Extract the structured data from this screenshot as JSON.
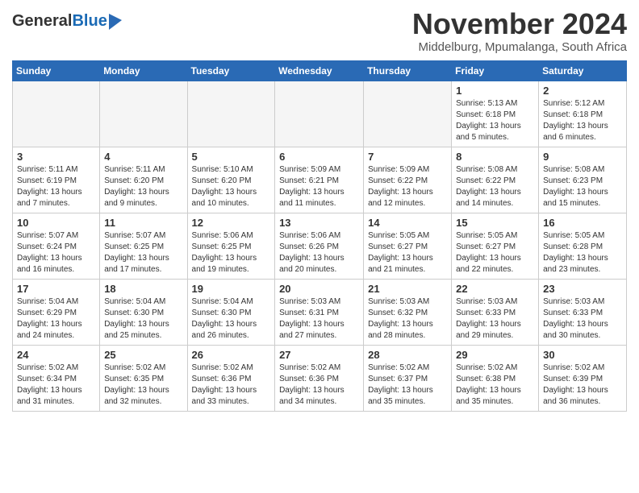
{
  "logo": {
    "general": "General",
    "blue": "Blue"
  },
  "title": "November 2024",
  "subtitle": "Middelburg, Mpumalanga, South Africa",
  "days_header": [
    "Sunday",
    "Monday",
    "Tuesday",
    "Wednesday",
    "Thursday",
    "Friday",
    "Saturday"
  ],
  "weeks": [
    [
      {
        "day": "",
        "info": ""
      },
      {
        "day": "",
        "info": ""
      },
      {
        "day": "",
        "info": ""
      },
      {
        "day": "",
        "info": ""
      },
      {
        "day": "",
        "info": ""
      },
      {
        "day": "1",
        "info": "Sunrise: 5:13 AM\nSunset: 6:18 PM\nDaylight: 13 hours and 5 minutes."
      },
      {
        "day": "2",
        "info": "Sunrise: 5:12 AM\nSunset: 6:18 PM\nDaylight: 13 hours and 6 minutes."
      }
    ],
    [
      {
        "day": "3",
        "info": "Sunrise: 5:11 AM\nSunset: 6:19 PM\nDaylight: 13 hours and 7 minutes."
      },
      {
        "day": "4",
        "info": "Sunrise: 5:11 AM\nSunset: 6:20 PM\nDaylight: 13 hours and 9 minutes."
      },
      {
        "day": "5",
        "info": "Sunrise: 5:10 AM\nSunset: 6:20 PM\nDaylight: 13 hours and 10 minutes."
      },
      {
        "day": "6",
        "info": "Sunrise: 5:09 AM\nSunset: 6:21 PM\nDaylight: 13 hours and 11 minutes."
      },
      {
        "day": "7",
        "info": "Sunrise: 5:09 AM\nSunset: 6:22 PM\nDaylight: 13 hours and 12 minutes."
      },
      {
        "day": "8",
        "info": "Sunrise: 5:08 AM\nSunset: 6:22 PM\nDaylight: 13 hours and 14 minutes."
      },
      {
        "day": "9",
        "info": "Sunrise: 5:08 AM\nSunset: 6:23 PM\nDaylight: 13 hours and 15 minutes."
      }
    ],
    [
      {
        "day": "10",
        "info": "Sunrise: 5:07 AM\nSunset: 6:24 PM\nDaylight: 13 hours and 16 minutes."
      },
      {
        "day": "11",
        "info": "Sunrise: 5:07 AM\nSunset: 6:25 PM\nDaylight: 13 hours and 17 minutes."
      },
      {
        "day": "12",
        "info": "Sunrise: 5:06 AM\nSunset: 6:25 PM\nDaylight: 13 hours and 19 minutes."
      },
      {
        "day": "13",
        "info": "Sunrise: 5:06 AM\nSunset: 6:26 PM\nDaylight: 13 hours and 20 minutes."
      },
      {
        "day": "14",
        "info": "Sunrise: 5:05 AM\nSunset: 6:27 PM\nDaylight: 13 hours and 21 minutes."
      },
      {
        "day": "15",
        "info": "Sunrise: 5:05 AM\nSunset: 6:27 PM\nDaylight: 13 hours and 22 minutes."
      },
      {
        "day": "16",
        "info": "Sunrise: 5:05 AM\nSunset: 6:28 PM\nDaylight: 13 hours and 23 minutes."
      }
    ],
    [
      {
        "day": "17",
        "info": "Sunrise: 5:04 AM\nSunset: 6:29 PM\nDaylight: 13 hours and 24 minutes."
      },
      {
        "day": "18",
        "info": "Sunrise: 5:04 AM\nSunset: 6:30 PM\nDaylight: 13 hours and 25 minutes."
      },
      {
        "day": "19",
        "info": "Sunrise: 5:04 AM\nSunset: 6:30 PM\nDaylight: 13 hours and 26 minutes."
      },
      {
        "day": "20",
        "info": "Sunrise: 5:03 AM\nSunset: 6:31 PM\nDaylight: 13 hours and 27 minutes."
      },
      {
        "day": "21",
        "info": "Sunrise: 5:03 AM\nSunset: 6:32 PM\nDaylight: 13 hours and 28 minutes."
      },
      {
        "day": "22",
        "info": "Sunrise: 5:03 AM\nSunset: 6:33 PM\nDaylight: 13 hours and 29 minutes."
      },
      {
        "day": "23",
        "info": "Sunrise: 5:03 AM\nSunset: 6:33 PM\nDaylight: 13 hours and 30 minutes."
      }
    ],
    [
      {
        "day": "24",
        "info": "Sunrise: 5:02 AM\nSunset: 6:34 PM\nDaylight: 13 hours and 31 minutes."
      },
      {
        "day": "25",
        "info": "Sunrise: 5:02 AM\nSunset: 6:35 PM\nDaylight: 13 hours and 32 minutes."
      },
      {
        "day": "26",
        "info": "Sunrise: 5:02 AM\nSunset: 6:36 PM\nDaylight: 13 hours and 33 minutes."
      },
      {
        "day": "27",
        "info": "Sunrise: 5:02 AM\nSunset: 6:36 PM\nDaylight: 13 hours and 34 minutes."
      },
      {
        "day": "28",
        "info": "Sunrise: 5:02 AM\nSunset: 6:37 PM\nDaylight: 13 hours and 35 minutes."
      },
      {
        "day": "29",
        "info": "Sunrise: 5:02 AM\nSunset: 6:38 PM\nDaylight: 13 hours and 35 minutes."
      },
      {
        "day": "30",
        "info": "Sunrise: 5:02 AM\nSunset: 6:39 PM\nDaylight: 13 hours and 36 minutes."
      }
    ]
  ]
}
